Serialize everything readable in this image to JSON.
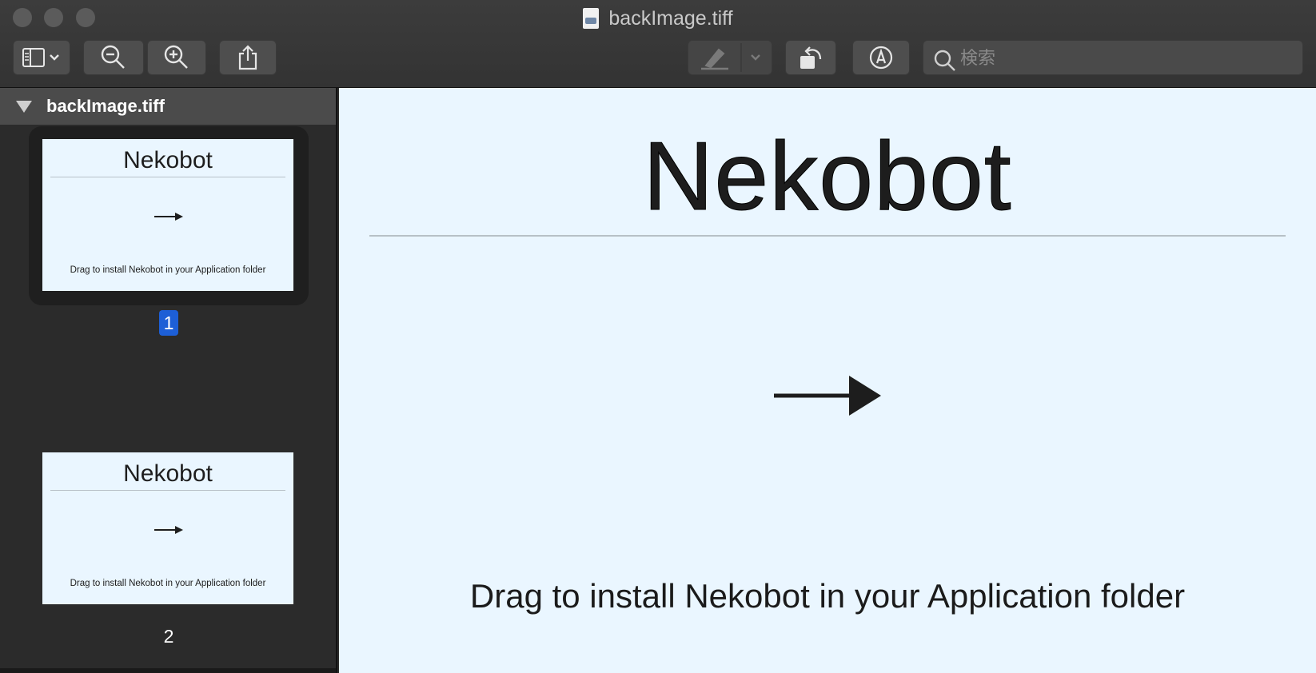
{
  "window": {
    "title": "backImage.tiff"
  },
  "toolbar": {
    "sidebar_toggle_icon": "sidebar-icon",
    "zoom_out_icon": "zoom-out-icon",
    "zoom_in_icon": "zoom-in-icon",
    "share_icon": "share-icon",
    "highlight_icon": "highlighter-icon",
    "rotate_icon": "rotate-icon",
    "markup_icon": "markup-icon",
    "search_placeholder": "検索"
  },
  "sidebar": {
    "file_name": "backImage.tiff",
    "pages": [
      {
        "number": "1",
        "title": "Nekobot",
        "caption": "Drag to install Nekobot in your Application folder",
        "selected": true
      },
      {
        "number": "2",
        "title": "Nekobot",
        "caption": "Drag to install Nekobot in your Application folder",
        "selected": false
      }
    ]
  },
  "document": {
    "title": "Nekobot",
    "caption": "Drag to install Nekobot in your Application folder",
    "background": "#eaf6ff"
  },
  "colors": {
    "selection": "#1d5fd6",
    "toolbar": "#3c3c3c"
  }
}
